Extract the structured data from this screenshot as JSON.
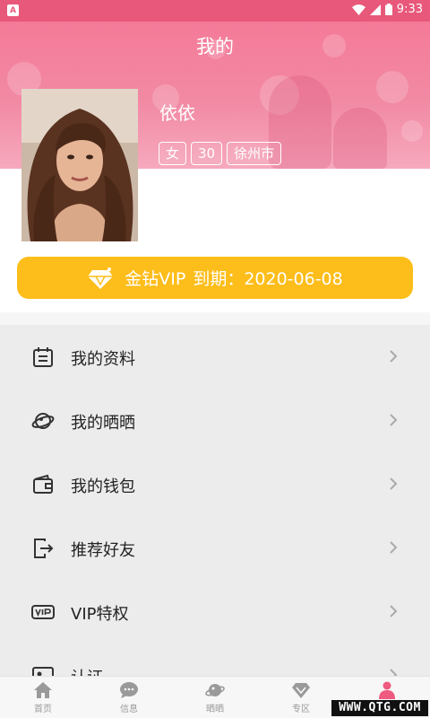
{
  "status_bar": {
    "time": "9:33"
  },
  "header": {
    "title": "我的"
  },
  "profile": {
    "name": "依依",
    "tags": [
      "女",
      "30",
      "徐州市"
    ]
  },
  "vip": {
    "label": "金钻VIP",
    "expiry_label": "到期：2020-06-08"
  },
  "menu": [
    {
      "label": "我的资料",
      "icon": "calendar-icon"
    },
    {
      "label": "我的晒晒",
      "icon": "planet-icon"
    },
    {
      "label": "我的钱包",
      "icon": "wallet-icon"
    },
    {
      "label": "推荐好友",
      "icon": "share-exit-icon"
    },
    {
      "label": "VIP特权",
      "icon": "vip-badge-icon"
    },
    {
      "label": "认证",
      "icon": "id-card-icon"
    }
  ],
  "bottom_nav": [
    {
      "label": "首页",
      "icon": "home-icon"
    },
    {
      "label": "信息",
      "icon": "chat-icon"
    },
    {
      "label": "晒晒",
      "icon": "planet-icon"
    },
    {
      "label": "专区",
      "icon": "diamond-icon"
    },
    {
      "label": "我的",
      "icon": "person-icon"
    }
  ],
  "colors": {
    "accent": "#e8587a",
    "vip": "#fdbd1a",
    "active_nav": "#ee5a80"
  },
  "watermark": "WWW.QTG.COM"
}
